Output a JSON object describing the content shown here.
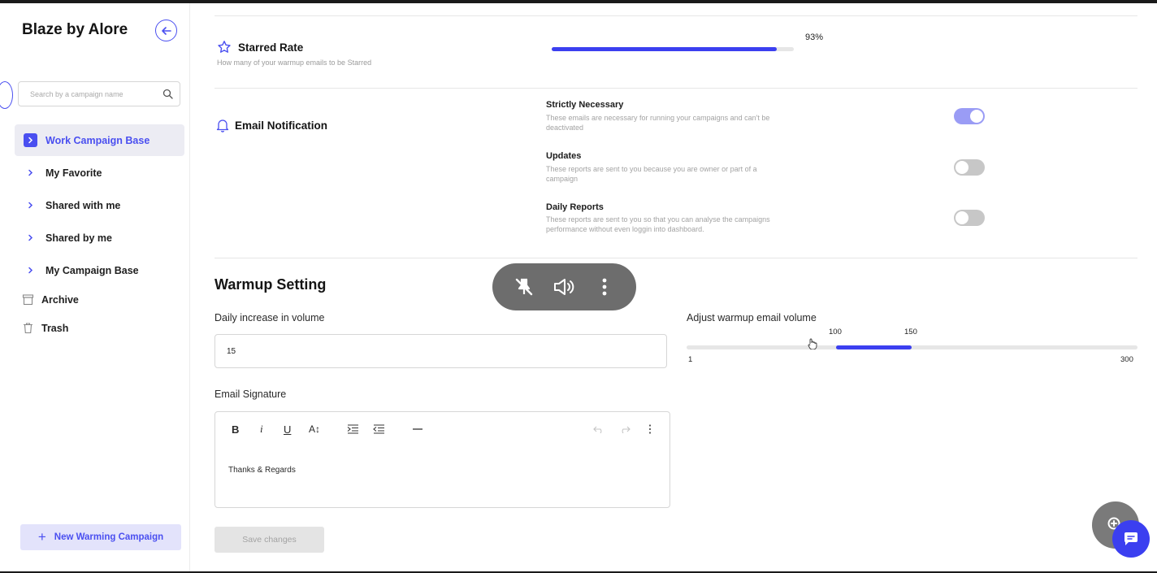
{
  "sidebar": {
    "brand": "Blaze by Alore",
    "search_placeholder": "Search by a campaign name",
    "nav": [
      {
        "label": "Work Campaign Base",
        "active": true
      },
      {
        "label": "My Favorite",
        "active": false
      },
      {
        "label": "Shared with me",
        "active": false
      },
      {
        "label": "Shared by me",
        "active": false
      },
      {
        "label": "My Campaign Base",
        "active": false
      }
    ],
    "archive_label": "Archive",
    "trash_label": "Trash",
    "new_campaign_label": "New Warming Campaign"
  },
  "starred": {
    "title": "Starred Rate",
    "description": "How many of your warmup emails to be Starred",
    "percent_label": "93%",
    "percent_value": 93
  },
  "email_notification": {
    "title": "Email Notification",
    "items": [
      {
        "label": "Strictly Necessary",
        "description": "These emails are necessary for running your campaigns and can't be deactivated",
        "enabled": true
      },
      {
        "label": "Updates",
        "description": "These reports are sent to you because you are owner or part of a campaign",
        "enabled": false
      },
      {
        "label": "Daily Reports",
        "description": "These reports are sent to you so that you can analyse the campaigns performance without even loggin into dashboard.",
        "enabled": false
      }
    ]
  },
  "warmup": {
    "title": "Warmup Setting",
    "daily_increase_label": "Daily increase in volume",
    "daily_increase_value": "15",
    "volume_label": "Adjust warmup email volume",
    "volume_min_label": "1",
    "volume_max_label": "300",
    "volume_low_label": "100",
    "volume_high_label": "150",
    "volume_min": 1,
    "volume_max": 300,
    "volume_low": 100,
    "volume_high": 150,
    "signature_label": "Email Signature",
    "signature_text": "Thanks & Regards",
    "save_label": "Save changes"
  },
  "toolbar": {
    "bold": "B",
    "italic": "i",
    "underline": "U",
    "font_size": "A↕"
  },
  "colors": {
    "accent": "#3b3ff0",
    "toggle_on": "#9a9cf5",
    "toggle_off": "#c7c7c7"
  }
}
